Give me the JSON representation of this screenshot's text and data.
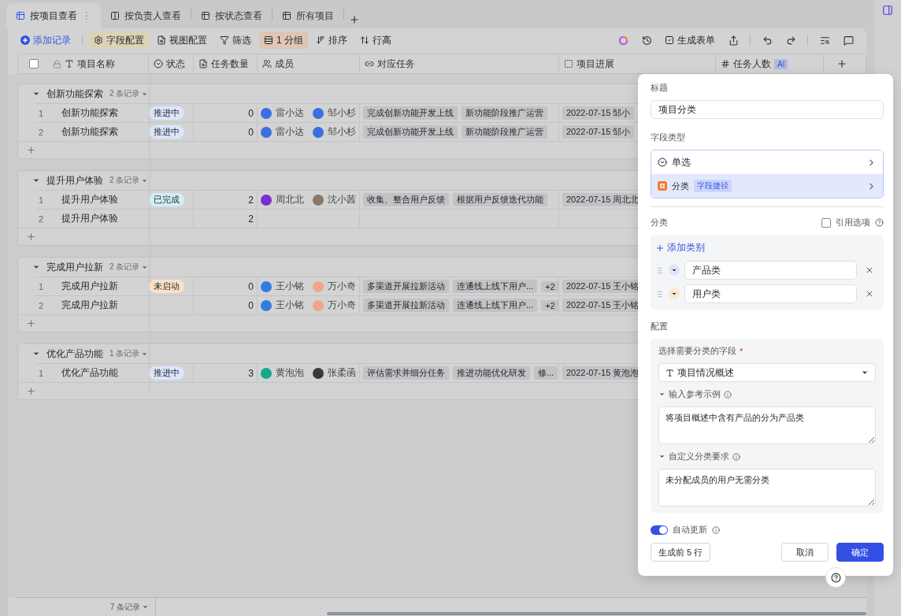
{
  "tabs": [
    {
      "label": "按项目查看",
      "kind": "grid",
      "selected": true,
      "more": "⋮"
    },
    {
      "label": "按负责人查看",
      "kind": "board",
      "selected": false
    },
    {
      "label": "按状态查看",
      "kind": "grid",
      "selected": false
    },
    {
      "label": "所有项目",
      "kind": "grid",
      "selected": false
    }
  ],
  "toolbar": [
    {
      "label": "添加记录",
      "kind": "add",
      "selected": false
    },
    {
      "label": "字段配置",
      "kind": "fields",
      "selected": true,
      "color": "#dbd3b4"
    },
    {
      "label": "视图配置",
      "kind": "view",
      "selected": false
    },
    {
      "label": "筛选",
      "kind": "filter",
      "selected": false
    },
    {
      "label": "1 分组",
      "kind": "group",
      "selected": true,
      "color": "#dfc5b3"
    },
    {
      "label": "排序",
      "kind": "sort",
      "selected": false
    },
    {
      "label": "行高",
      "kind": "height",
      "selected": false
    }
  ],
  "form_button": "生成表单",
  "select_all_checked": false,
  "columns": [
    {
      "label": "项目名称",
      "kind": "text"
    },
    {
      "label": "状态",
      "kind": "select"
    },
    {
      "label": "任务数量",
      "kind": "number"
    },
    {
      "label": "成员",
      "kind": "person"
    },
    {
      "label": "对应任务",
      "kind": "link"
    },
    {
      "label": "项目进展",
      "kind": "progress"
    },
    {
      "label": "任务人数",
      "kind": "hash",
      "badge": "AI"
    }
  ],
  "groups": [
    {
      "title": "创新功能探索",
      "count": "2 条记录",
      "rows": [
        {
          "index": "1",
          "name": "创新功能探索",
          "status": {
            "label": "推进中",
            "color": "#dde5fb"
          },
          "task_count": "0",
          "members": [
            {
              "name": "雷小达",
              "color": "#3b6fe0"
            },
            {
              "name": "邹小杉",
              "color": "#3b6fe0"
            }
          ],
          "tasks": [
            "完成创新功能开发上线",
            "新功能阶段推广运营"
          ],
          "progress": "2022-07-15 邹小"
        },
        {
          "index": "2",
          "name": "创新功能探索",
          "status": {
            "label": "推进中",
            "color": "#dde5fb"
          },
          "task_count": "0",
          "members": [
            {
              "name": "雷小达",
              "color": "#3b6fe0"
            },
            {
              "name": "邹小杉",
              "color": "#3b6fe0"
            }
          ],
          "tasks": [
            "完成创新功能开发上线",
            "新功能阶段推广运营"
          ],
          "progress": "2022-07-15 邹小"
        }
      ]
    },
    {
      "title": "提升用户体验",
      "count": "2 条记录",
      "rows": [
        {
          "index": "1",
          "name": "提升用户体验",
          "status": {
            "label": "已完成",
            "color": "#d2eef3"
          },
          "task_count": "2",
          "members": [
            {
              "name": "周北北",
              "color": "#7b2fd0"
            },
            {
              "name": "沈小茜",
              "color": "#8a7868"
            }
          ],
          "tasks": [
            "收集、整合用户反馈",
            "根据用户反馈迭代功能"
          ],
          "progress": "2022-07-15 周北北"
        },
        {
          "index": "2",
          "name": "提升用户体验",
          "task_count": "2"
        }
      ]
    },
    {
      "title": "完成用户拉新",
      "count": "2 条记录",
      "rows": [
        {
          "index": "1",
          "name": "完成用户拉新",
          "status": {
            "label": "未启动",
            "color": "#fbe2c6"
          },
          "task_count": "0",
          "members": [
            {
              "name": "王小铭",
              "color": "#2f7de0"
            },
            {
              "name": "万小奇",
              "color": "#f0a58e"
            }
          ],
          "tasks": [
            "多渠道开展拉新活动",
            "连通线上线下用户..."
          ],
          "more": "+2",
          "progress": "2022-07-15 王小铭"
        },
        {
          "index": "2",
          "name": "完成用户拉新",
          "task_count": "0",
          "members": [
            {
              "name": "王小铭",
              "color": "#2f7de0"
            },
            {
              "name": "万小奇",
              "color": "#f0a58e"
            }
          ],
          "tasks": [
            "多渠道开展拉新活动",
            "连通线上线下用户..."
          ],
          "more": "+2",
          "progress": "2022-07-15 王小铭"
        }
      ]
    },
    {
      "title": "优化产品功能",
      "count": "1 条记录",
      "rows": [
        {
          "index": "1",
          "name": "优化产品功能",
          "status": {
            "label": "推进中",
            "color": "#dde5fb"
          },
          "task_count": "3",
          "members": [
            {
              "name": "黄泡泡",
              "color": "#17a88a"
            },
            {
              "name": "张柔函",
              "color": "#3a3a3a"
            }
          ],
          "tasks": [
            "评估需求并细分任务",
            "推进功能优化研发",
            "修..."
          ],
          "progress": "2022-07-15 黄泡泡"
        }
      ]
    }
  ],
  "footer": {
    "count": "7 条记录"
  },
  "panel": {
    "title_label": "标题",
    "title_value": "项目分类",
    "type_label": "字段类型",
    "type_options": [
      {
        "label": "单选",
        "kind": "select",
        "selected": false
      },
      {
        "label": "分类",
        "kind": "category",
        "badge": "字段捷径",
        "selected": true
      }
    ],
    "category_label": "分类",
    "reference": {
      "label": "引用选项",
      "checked": false
    },
    "add_label": "添加类别",
    "categories": [
      {
        "value": "产品类",
        "color": "#dce5fd"
      },
      {
        "value": "用户类",
        "color": "#fde6cf"
      }
    ],
    "config_label": "配置",
    "field_label": "选择需要分类的字段",
    "required_mark": "*",
    "field_value": "项目情况概述",
    "example_label": "输入参考示例",
    "example_value": "将项目概述中含有产品的分为产品类",
    "rule_label": "自定义分类要求",
    "rule_value": "未分配成员的用户无需分类",
    "auto_update": {
      "label": "自动更新",
      "on": true
    },
    "preview_button": "生成前 5 行",
    "cancel_button": "取消",
    "confirm_button": "确定"
  }
}
